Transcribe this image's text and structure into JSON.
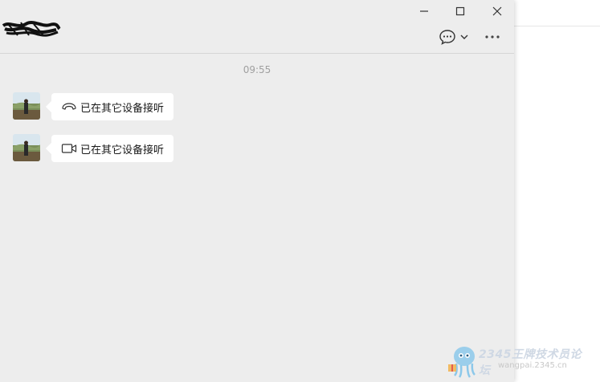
{
  "window": {
    "title": "",
    "controls": {
      "minimize": "minimize",
      "maximize": "maximize",
      "close": "close"
    }
  },
  "header": {
    "chat_bubble_icon": "chat-bubble-icon",
    "dropdown_icon": "chevron-down-icon",
    "more_icon": "more-icon"
  },
  "conversation": {
    "timestamp": "09:55",
    "messages": [
      {
        "icon": "phone-hangup-icon",
        "text": "已在其它设备接听"
      },
      {
        "icon": "video-camera-icon",
        "text": "已在其它设备接听"
      }
    ]
  },
  "watermark": {
    "text": "2345王牌技术员论坛",
    "url": "wangpai.2345.cn"
  },
  "colors": {
    "chat_bg": "#ededed",
    "bubble_bg": "#ffffff",
    "timestamp": "#a0a0a0"
  }
}
